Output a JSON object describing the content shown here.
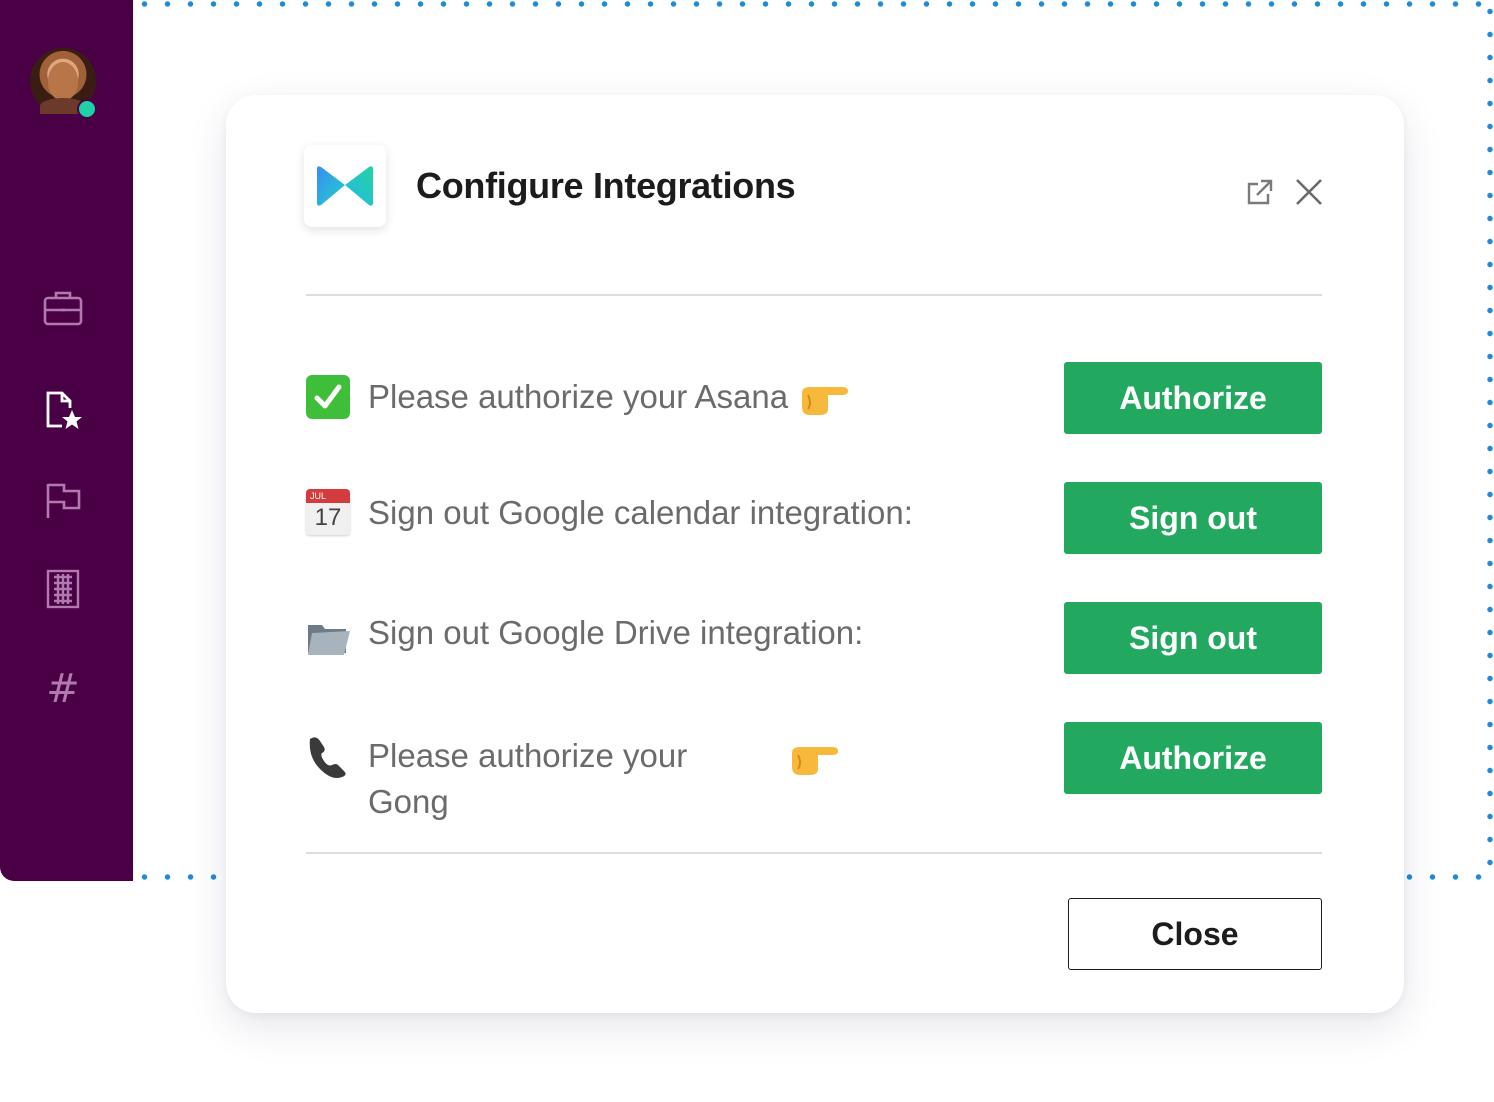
{
  "sidebar": {
    "avatar_alt": "User avatar",
    "status": "online",
    "icons": [
      "briefcase-icon",
      "document-star-icon",
      "flag-icon",
      "building-icon",
      "hash-icon"
    ],
    "hash_glyph": "#"
  },
  "modal": {
    "title": "Configure Integrations",
    "rows": [
      {
        "emoji": "check-mark-icon",
        "label": "Please authorize your Asana",
        "button": "Authorize"
      },
      {
        "emoji": "calendar-icon",
        "label": "Sign out Google calendar integration:",
        "button": "Sign out",
        "calendar_month": "JUL",
        "calendar_day": "17"
      },
      {
        "emoji": "folder-icon",
        "label": "Sign out Google Drive integration:",
        "button": "Sign out"
      },
      {
        "emoji": "telephone-icon",
        "label_line1": "Please authorize your",
        "label_line2": "Gong",
        "button": "Authorize"
      }
    ],
    "close_label": "Close"
  },
  "colors": {
    "sidebar_bg": "#4a0045",
    "button_green": "#23a95f",
    "dots": "#1e8ad8",
    "status_green": "#20d0a8"
  }
}
